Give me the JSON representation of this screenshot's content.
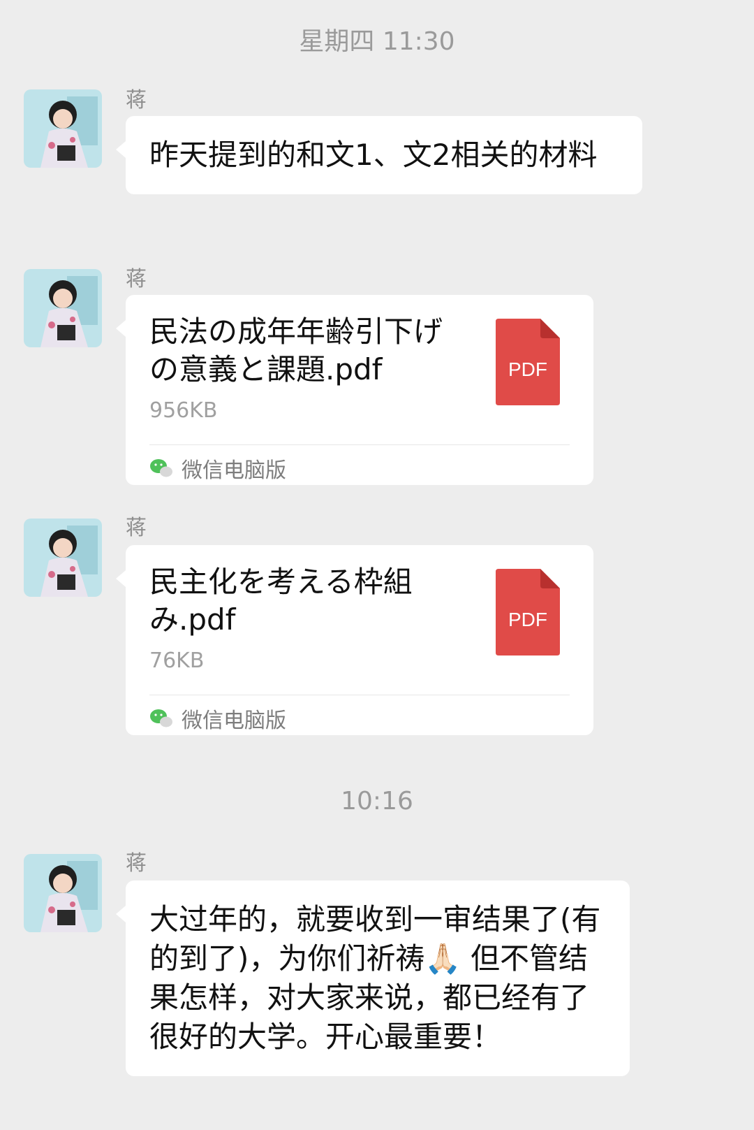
{
  "timestamps": [
    "星期四 11:30",
    "10:16"
  ],
  "messages": [
    {
      "sender": "蒋",
      "text": "昨天提到的和文1、文2相关的材料"
    },
    {
      "sender": "蒋",
      "file_name": "民法の成年年齢引下げの意義と課題.pdf",
      "file_size": "956KB",
      "footer": "微信电脑版",
      "file_icon_label": "PDF"
    },
    {
      "sender": "蒋",
      "file_name": "民主化を考える枠組み.pdf",
      "file_size": "76KB",
      "footer": "微信电脑版",
      "file_icon_label": "PDF"
    },
    {
      "sender": "蒋",
      "text": "大过年的，就要收到一审结果了(有的到了)，为你们祈祷🙏🏻 但不管结果怎样，对大家来说，都已经有了很好的大学。开心最重要！"
    }
  ],
  "colors": {
    "background": "#ededed",
    "bubble": "#ffffff",
    "pdf": "#e04b48",
    "wechat": "#4fc15a"
  }
}
